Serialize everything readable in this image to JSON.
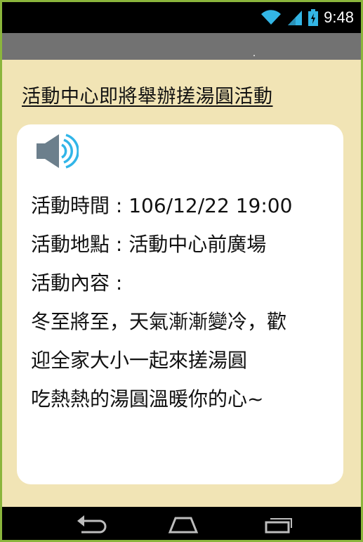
{
  "status_bar": {
    "time": "9:48",
    "icons": [
      "wifi-icon",
      "signal-icon",
      "battery-icon"
    ]
  },
  "content": {
    "headline": "活動中心即將舉辦搓湯圓活動",
    "card": {
      "speaker_icon": "speaker-icon",
      "lines": [
        "活動時間 : 106/12/22 19:00",
        "活動地點 : 活動中心前廣場",
        "活動內容 :",
        "冬至將至，天氣漸漸變冷，歡",
        "迎全家大小一起來搓湯圓",
        "吃熱熱的湯圓溫暖你的心~"
      ]
    }
  },
  "nav_bar": {
    "buttons": [
      "back-icon",
      "home-icon",
      "recent-apps-icon"
    ]
  },
  "colors": {
    "background": "#f1e4b5",
    "card": "#ffffff",
    "frame_border": "#8bb53c",
    "titlebar": "#727272",
    "speaker_body": "#6c7f8c",
    "speaker_waves": "#31b5e8",
    "status_icons": "#33b5e5"
  }
}
